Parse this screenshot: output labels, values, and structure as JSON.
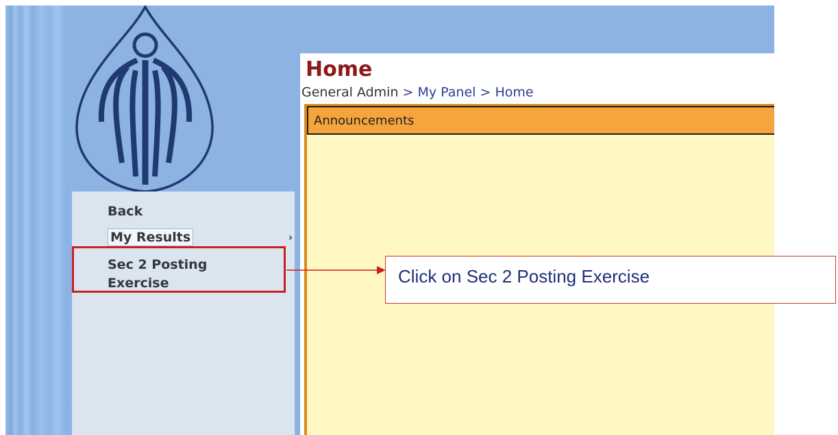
{
  "page": {
    "title": "Home",
    "breadcrumb": {
      "items": [
        "General Admin",
        "My Panel",
        "Home"
      ],
      "separator": ">"
    }
  },
  "menu": {
    "items": [
      {
        "label": "Back"
      },
      {
        "label": "My Results",
        "submenu_arrow": "›"
      },
      {
        "label_line1": "Sec 2 Posting",
        "label_line2": "Exercise"
      }
    ]
  },
  "panel": {
    "title": "Announcements"
  },
  "callout": {
    "text": "Click on Sec 2 Posting Exercise"
  },
  "colors": {
    "sidebar_bg": "#8db3e2",
    "menu_bg": "#dbe5f0",
    "title_red": "#8b1a1a",
    "link_blue": "#2c3e8f",
    "panel_header": "#f5a53c",
    "panel_body": "#fff8c3",
    "highlight_red": "#cc1e1e"
  },
  "icons": {
    "logo": "leaf-drop-logo-icon",
    "arrow": "arrow-right-icon"
  }
}
